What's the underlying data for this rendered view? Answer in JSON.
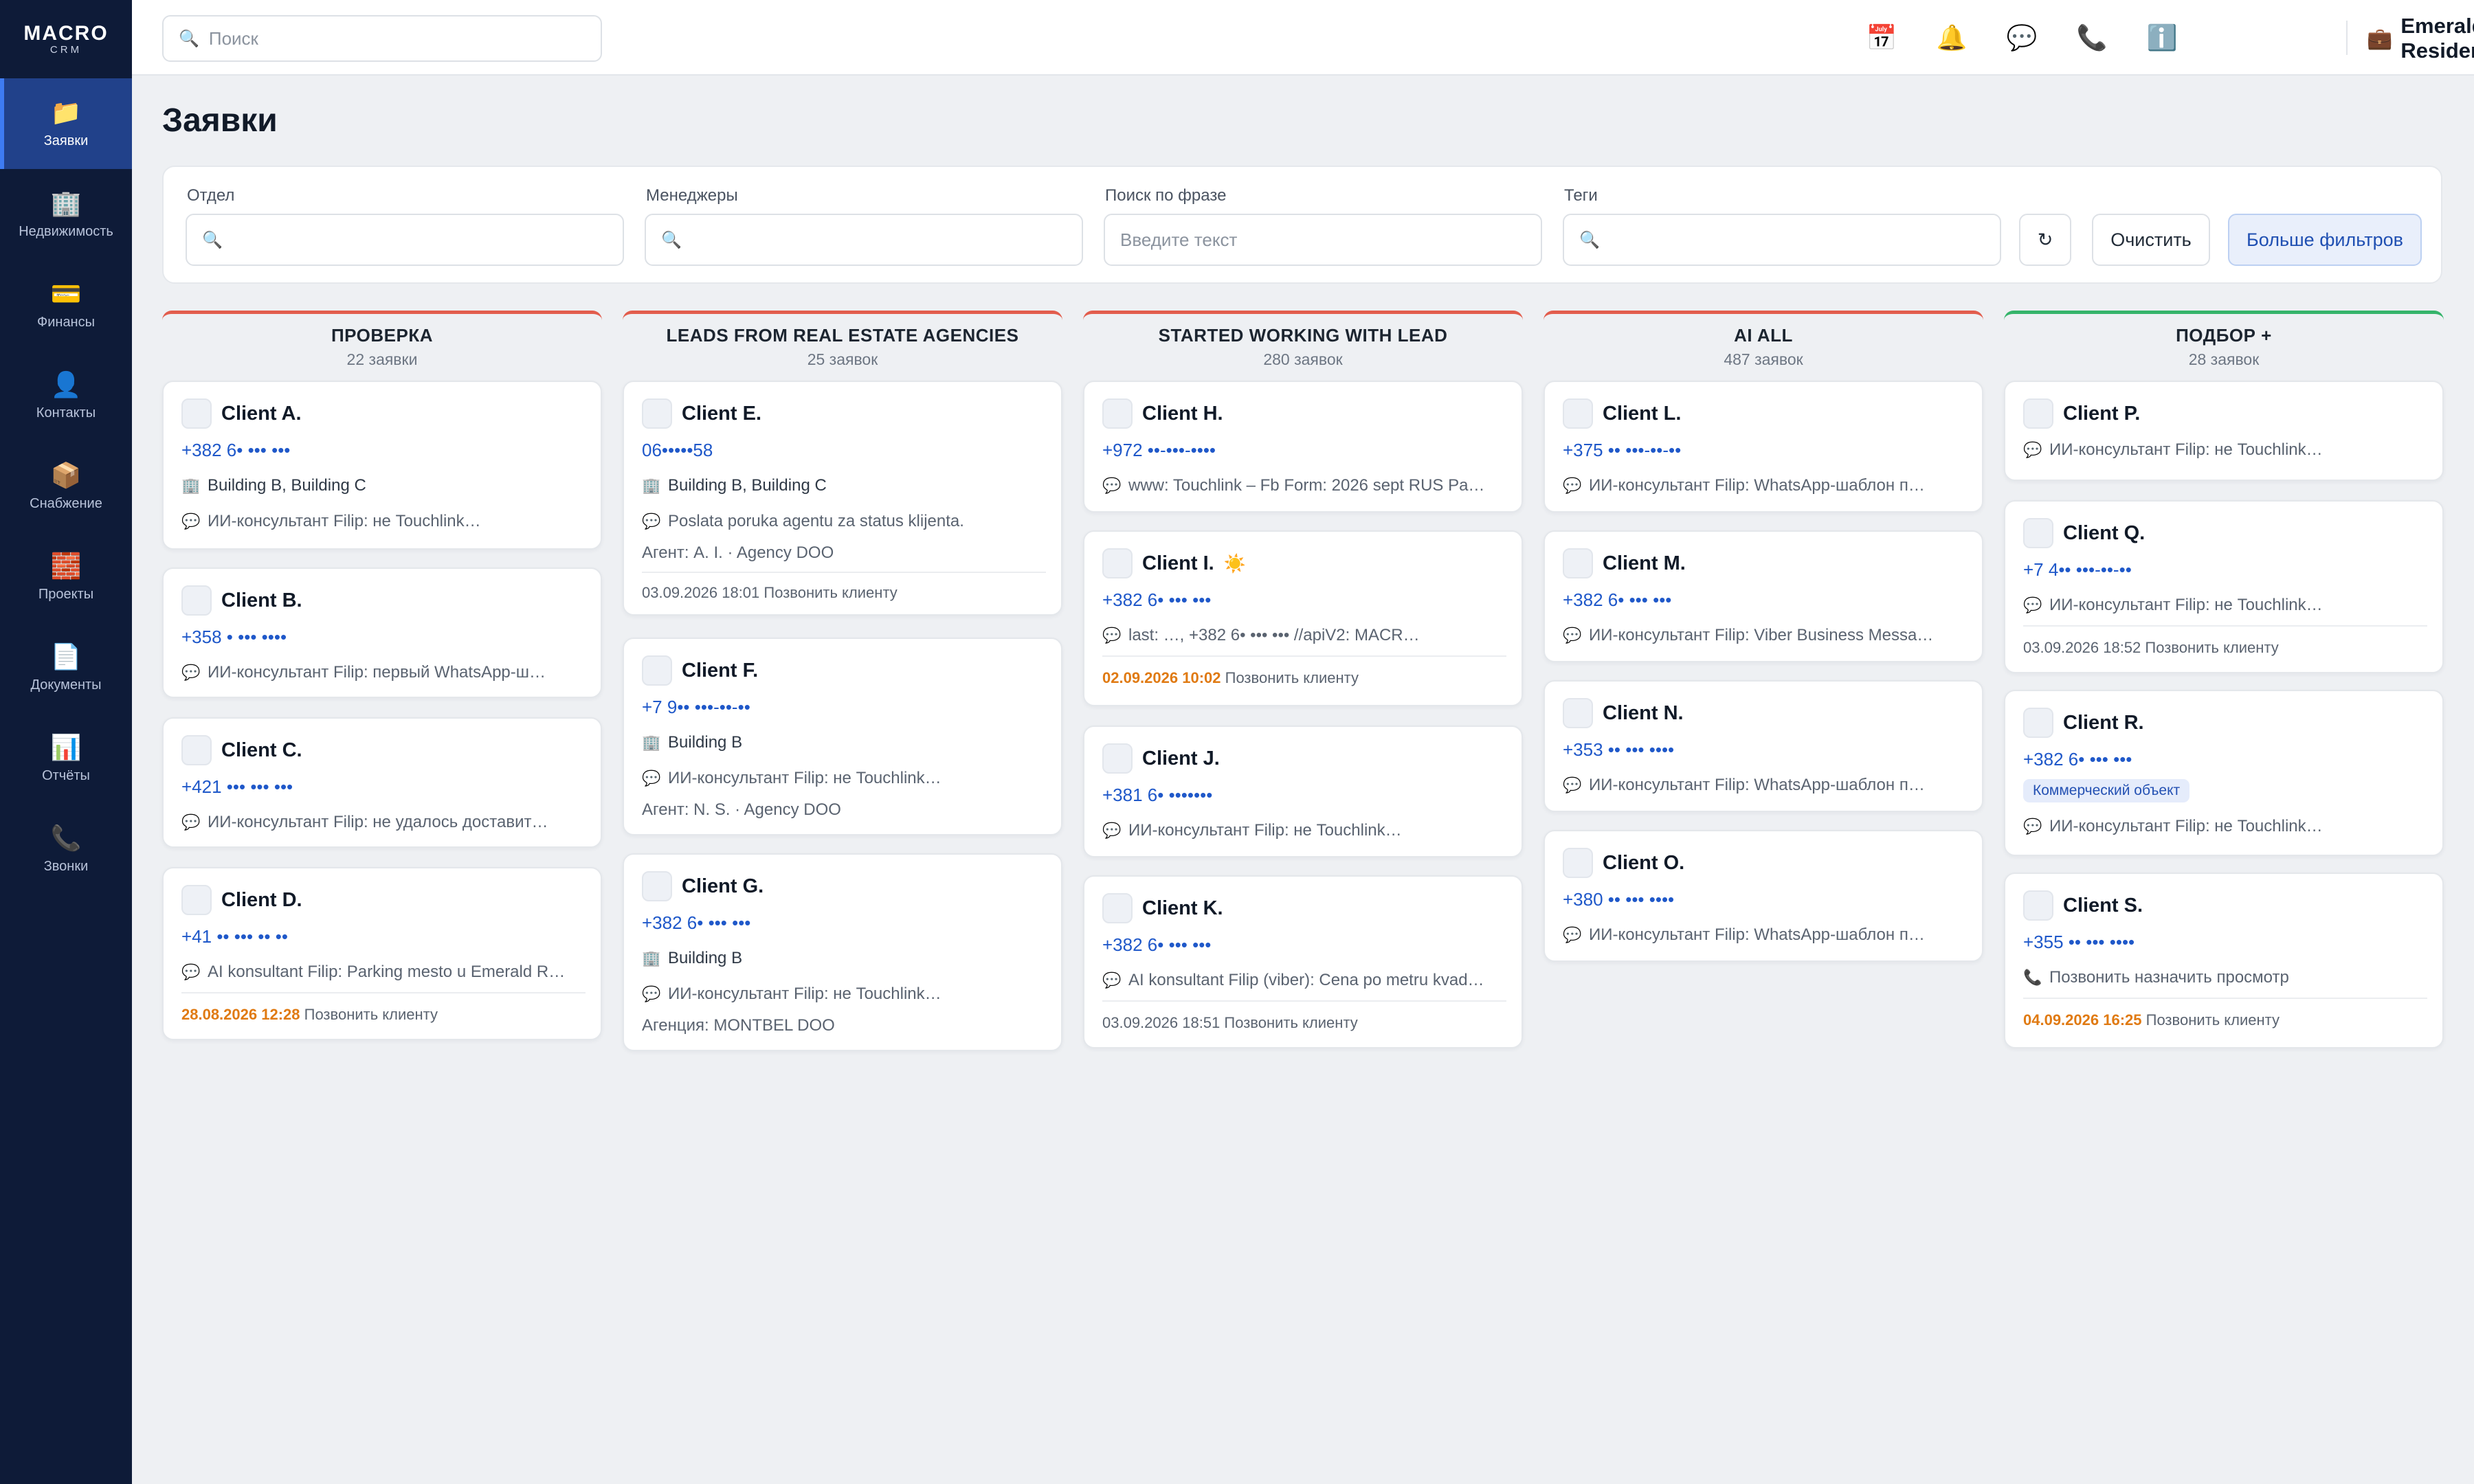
{
  "app": {
    "logo_main": "MACRO",
    "logo_sub": "CRM"
  },
  "sidebar": {
    "items": [
      {
        "label": "Заявки",
        "icon": "📁"
      },
      {
        "label": "Недвижимость",
        "icon": "🏢"
      },
      {
        "label": "Финансы",
        "icon": "💳"
      },
      {
        "label": "Контакты",
        "icon": "👤"
      },
      {
        "label": "Снабжение",
        "icon": "📦"
      },
      {
        "label": "Проекты",
        "icon": "🧱"
      },
      {
        "label": "Документы",
        "icon": "📄"
      },
      {
        "label": "Отчёты",
        "icon": "📊"
      },
      {
        "label": "Звонки",
        "icon": "📞"
      }
    ]
  },
  "topbar": {
    "search_placeholder": "Поиск",
    "icons": {
      "calendar": "📅",
      "bell": "🔔",
      "chat": "💬",
      "phone": "📞",
      "info": "ℹ️",
      "company": "💼"
    },
    "company": "Emerald Residence"
  },
  "page": {
    "title": "Заявки"
  },
  "filters": {
    "department_label": "Отдел",
    "managers_label": "Менеджеры",
    "phrase_label": "Поиск по фразе",
    "phrase_placeholder": "Введите текст",
    "tags_label": "Теги",
    "refresh": "↻",
    "clear": "Очистить",
    "more": "Больше фильтров"
  },
  "icons": {
    "search": "🔍",
    "building": "🏢",
    "message": "💬",
    "phone": "📞",
    "star": "☀️"
  },
  "columns": [
    {
      "title": "ПРОВЕРКА",
      "count": "22 заявки",
      "cards": [
        {
          "name": "Client A.",
          "phone": "+382 6• ••• •••",
          "building": "Building B, Building C",
          "message": "ИИ-консультант Filip: не Touchlink…"
        },
        {
          "name": "Client B.",
          "phone": "+358 • ••• ••••",
          "message": "ИИ-консультант Filip: первый WhatsApp-ш…"
        },
        {
          "name": "Client C.",
          "phone": "+421 ••• ••• •••",
          "message": "ИИ-консультант Filip: не удалось доставит…"
        },
        {
          "name": "Client D.",
          "phone": "+41 •• ••• •• ••",
          "message": "AI konsultant Filip: Parking mesto u Emerald R…",
          "due_date": "28.08.2026 12:28",
          "due_text": "Позвонить клиенту"
        }
      ]
    },
    {
      "title": "LEADS FROM REAL ESTATE AGENCIES",
      "count": "25 заявок",
      "cards": [
        {
          "name": "Client E.",
          "phone": "06•••••58",
          "building": "Building B, Building C",
          "message": "Poslata poruka agentu za status klijenta.",
          "agent": "Агент: A. I. · Agency DOO",
          "due_plain": "03.09.2026 18:01",
          "due_text": "Позвонить клиенту"
        },
        {
          "name": "Client F.",
          "phone": "+7 9•• •••-••-••",
          "building": "Building B",
          "message": "ИИ-консультант Filip: не Touchlink…",
          "agent": "Агент: N. S. · Agency DOO"
        },
        {
          "name": "Client G.",
          "phone": "+382 6• ••• •••",
          "building": "Building B",
          "message": "ИИ-консультант Filip: не Touchlink…",
          "agent": "Агенция: MONTBEL DOO"
        }
      ]
    },
    {
      "title": "STARTED WORKING WITH LEAD",
      "count": "280 заявок",
      "cards": [
        {
          "name": "Client H.",
          "phone": "+972 ••-•••-••••",
          "message": "www: Touchlink – Fb Form: 2026 sept RUS Pa…"
        },
        {
          "name": "Client I.",
          "phone": "+382 6• ••• •••",
          "message": "last: …, +382 6• ••• ••• //apiV2: MACR…",
          "due_date": "02.09.2026 10:02",
          "due_text": "Позвонить клиенту"
        },
        {
          "name": "Client J.",
          "phone": "+381 6• •••••••",
          "message": "ИИ-консультант Filip: не Touchlink…"
        },
        {
          "name": "Client K.",
          "phone": "+382 6• ••• •••",
          "message": "AI konsultant Filip (viber): Cena po metru kvad…",
          "due_plain": "03.09.2026 18:51",
          "due_text": "Позвонить клиенту"
        }
      ]
    },
    {
      "title": "AI ALL",
      "count": "487 заявок",
      "cards": [
        {
          "name": "Client L.",
          "phone": "+375 •• •••-••-••",
          "message": "ИИ-консультант Filip: WhatsApp-шаблон п…"
        },
        {
          "name": "Client M.",
          "phone": "+382 6• ••• •••",
          "message": "ИИ-консультант Filip: Viber Business Messa…"
        },
        {
          "name": "Client N.",
          "phone": "+353 •• ••• ••••",
          "message": "ИИ-консультант Filip: WhatsApp-шаблон п…"
        },
        {
          "name": "Client O.",
          "phone": "+380 •• ••• ••••",
          "message": "ИИ-консультант Filip: WhatsApp-шаблон п…"
        }
      ]
    },
    {
      "title": "ПОДБОР +",
      "count": "28 заявок",
      "cards": [
        {
          "name": "Client P.",
          "message": "ИИ-консультант Filip: не Touchlink…"
        },
        {
          "name": "Client Q.",
          "phone": "+7 4•• •••-••-••",
          "message": "ИИ-консультант Filip: не Touchlink…",
          "due_plain": "03.09.2026 18:52",
          "due_text": "Позвонить клиенту"
        },
        {
          "name": "Client R.",
          "phone": "+382 6• ••• •••",
          "tag": "Коммерческий объект",
          "message": "ИИ-консультант Filip: не Touchlink…"
        },
        {
          "name": "Client S.",
          "phone": "+355 •• ••• ••••",
          "call_note": "Позвонить назначить просмотр",
          "due_date": "04.09.2026 16:25",
          "due_text": "Позвонить клиенту"
        }
      ]
    }
  ]
}
